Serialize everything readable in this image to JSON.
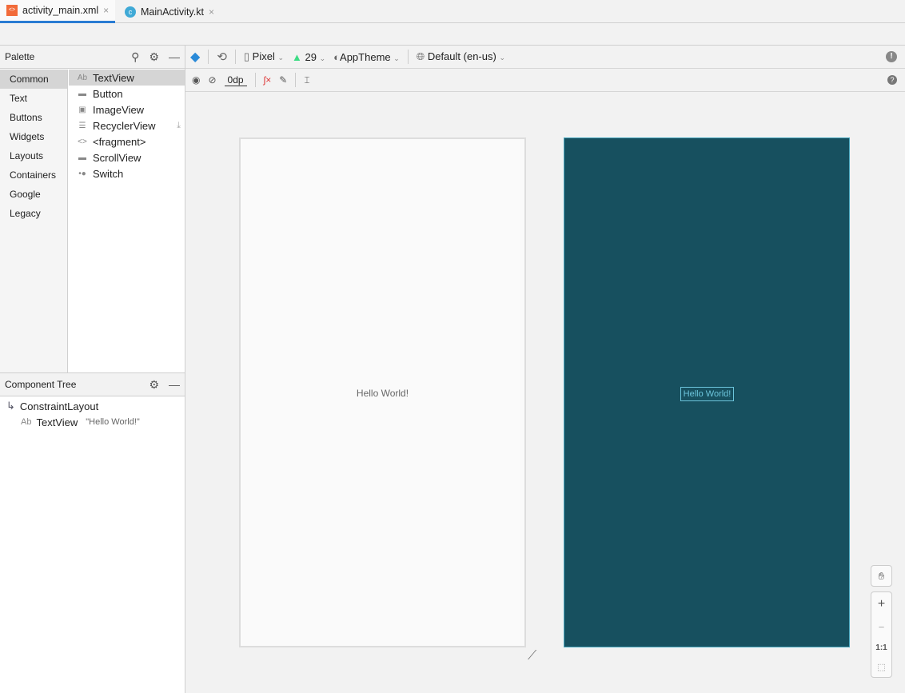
{
  "tabs": [
    {
      "label": "activity_main.xml",
      "close": "×"
    },
    {
      "label": "MainActivity.kt",
      "close": "×"
    }
  ],
  "palette": {
    "title": "Palette",
    "categories": [
      "Common",
      "Text",
      "Buttons",
      "Widgets",
      "Layouts",
      "Containers",
      "Google",
      "Legacy"
    ],
    "items": [
      {
        "icon": "Ab",
        "label": "TextView"
      },
      {
        "icon": "▬",
        "label": "Button"
      },
      {
        "icon": "▣",
        "label": "ImageView"
      },
      {
        "icon": "☰",
        "label": "RecyclerView"
      },
      {
        "icon": "<>",
        "label": "<fragment>"
      },
      {
        "icon": "▬",
        "label": "ScrollView"
      },
      {
        "icon": "•●",
        "label": "Switch"
      }
    ]
  },
  "tree": {
    "title": "Component Tree",
    "root": "ConstraintLayout",
    "child_icon": "Ab",
    "child": "TextView",
    "child_text": "\"Hello World!\""
  },
  "toolbar": {
    "device": "Pixel",
    "api": "29",
    "theme": "AppTheme",
    "locale": "Default (en-us)",
    "margin": "0dp"
  },
  "canvas": {
    "text": "Hello World!"
  },
  "zoom": {
    "plus": "+",
    "minus": "−",
    "one": "1:1"
  }
}
